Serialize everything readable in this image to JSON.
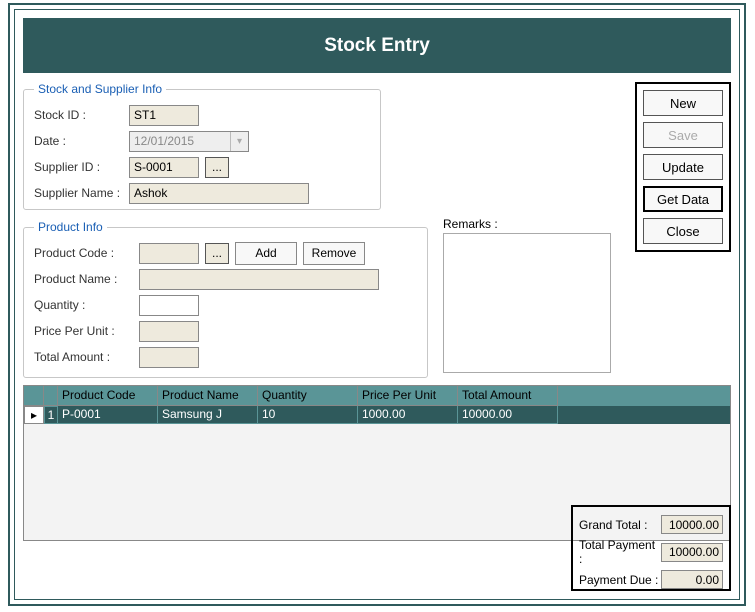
{
  "header": {
    "title": "Stock Entry"
  },
  "stock": {
    "legend": "Stock and Supplier Info",
    "stock_id_label": "Stock ID :",
    "stock_id": "ST1",
    "date_label": "Date :",
    "date": "12/01/2015",
    "supplier_id_label": "Supplier ID :",
    "supplier_id": "S-0001",
    "supplier_name_label": "Supplier Name :",
    "supplier_name": "Ashok"
  },
  "product": {
    "legend": "Product Info",
    "code_label": "Product Code :",
    "code": "",
    "name_label": "Product Name :",
    "name": "",
    "qty_label": "Quantity :",
    "qty": "",
    "ppu_label": "Price Per Unit :",
    "ppu": "",
    "total_label": "Total Amount :",
    "total": "",
    "add_label": "Add",
    "remove_label": "Remove",
    "browse_tooltip": "..."
  },
  "remarks": {
    "label": "Remarks :",
    "text": ""
  },
  "side": {
    "new": "New",
    "save": "Save",
    "update": "Update",
    "get_data": "Get Data",
    "close": "Close"
  },
  "grid": {
    "columns": [
      "Product Code",
      "Product Name",
      "Quantity",
      "Price Per Unit",
      "Total Amount"
    ],
    "rows": [
      {
        "idx": "1",
        "code": "P-0001",
        "name": "Samsung J",
        "qty": "10",
        "ppu": "1000.00",
        "total": "10000.00"
      }
    ]
  },
  "totals": {
    "grand_total_label": "Grand Total :",
    "grand_total": "10000.00",
    "total_payment_label": "Total Payment :",
    "total_payment": "10000.00",
    "payment_due_label": "Payment Due :",
    "payment_due": "0.00"
  }
}
